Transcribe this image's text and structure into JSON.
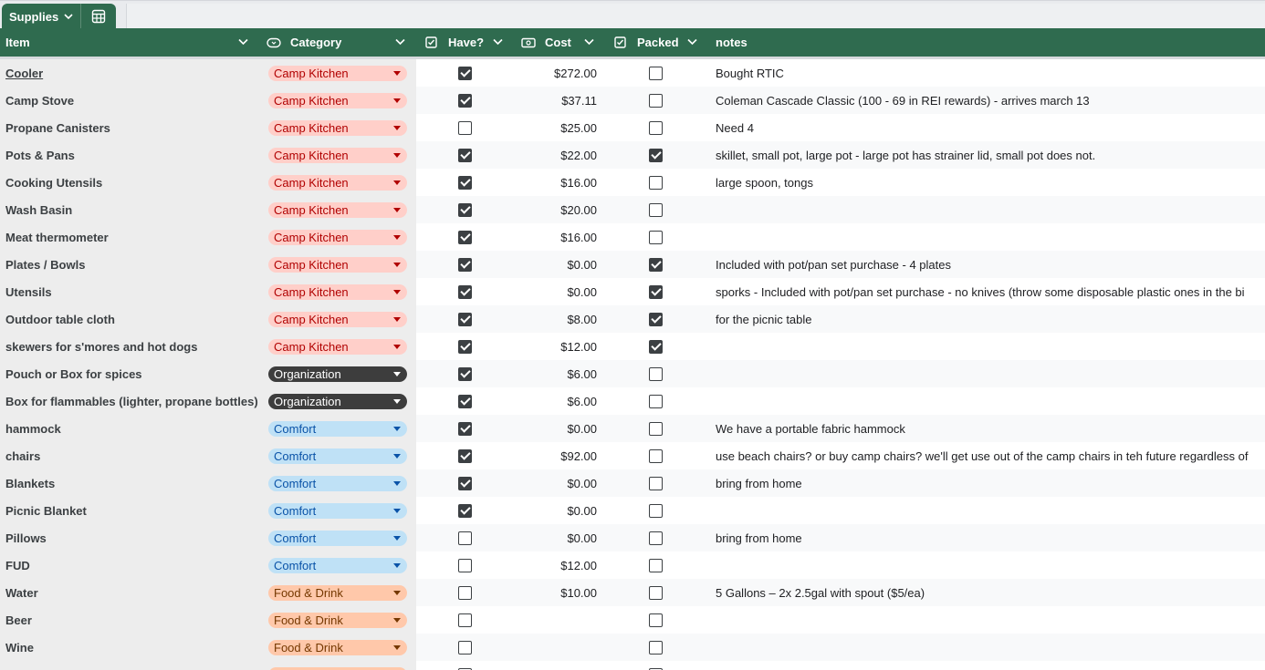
{
  "sheet": {
    "tab_name": "Supplies"
  },
  "columns": {
    "item": "Item",
    "category": "Category",
    "have": "Have?",
    "cost": "Cost",
    "packed": "Packed",
    "notes": "notes"
  },
  "category_styles": {
    "Camp Kitchen": {
      "bg": "#ffcfc9",
      "fg": "#b10202"
    },
    "Organization": {
      "bg": "#3d3d3d",
      "fg": "#ffffff"
    },
    "Comfort": {
      "bg": "#bfe1f6",
      "fg": "#0a53a8"
    },
    "Food & Drink": {
      "bg": "#ffc8aa",
      "fg": "#753800"
    }
  },
  "rows": [
    {
      "item": "Cooler",
      "category": "Camp Kitchen",
      "have": true,
      "cost": "$272.00",
      "packed": false,
      "notes": "Bought RTIC"
    },
    {
      "item": "Camp Stove",
      "category": "Camp Kitchen",
      "have": true,
      "cost": "$37.11",
      "packed": false,
      "notes": "Coleman Cascade Classic (100 - 69 in REI rewards) - arrives march 13"
    },
    {
      "item": "Propane Canisters",
      "category": "Camp Kitchen",
      "have": false,
      "cost": "$25.00",
      "packed": false,
      "notes": "Need 4"
    },
    {
      "item": "Pots & Pans",
      "category": "Camp Kitchen",
      "have": true,
      "cost": "$22.00",
      "packed": true,
      "notes": "skillet, small pot, large pot - large pot has strainer lid, small pot does not."
    },
    {
      "item": "Cooking Utensils",
      "category": "Camp Kitchen",
      "have": true,
      "cost": "$16.00",
      "packed": false,
      "notes": "large spoon, tongs"
    },
    {
      "item": "Wash Basin",
      "category": "Camp Kitchen",
      "have": true,
      "cost": "$20.00",
      "packed": false,
      "notes": ""
    },
    {
      "item": "Meat thermometer",
      "category": "Camp Kitchen",
      "have": true,
      "cost": "$16.00",
      "packed": false,
      "notes": ""
    },
    {
      "item": "Plates / Bowls",
      "category": "Camp Kitchen",
      "have": true,
      "cost": "$0.00",
      "packed": true,
      "notes": "Included with pot/pan set purchase - 4 plates"
    },
    {
      "item": "Utensils",
      "category": "Camp Kitchen",
      "have": true,
      "cost": "$0.00",
      "packed": true,
      "notes": "sporks - Included with pot/pan set purchase - no knives (throw some disposable plastic ones in the bi"
    },
    {
      "item": "Outdoor table cloth",
      "category": "Camp Kitchen",
      "have": true,
      "cost": "$8.00",
      "packed": true,
      "notes": "for the picnic table"
    },
    {
      "item": "skewers for s'mores and hot dogs",
      "category": "Camp Kitchen",
      "have": true,
      "cost": "$12.00",
      "packed": true,
      "notes": ""
    },
    {
      "item": "Pouch or Box for spices",
      "category": "Organization",
      "have": true,
      "cost": "$6.00",
      "packed": false,
      "notes": ""
    },
    {
      "item": "Box for flammables (lighter, propane bottles)",
      "category": "Organization",
      "have": true,
      "cost": "$6.00",
      "packed": false,
      "notes": ""
    },
    {
      "item": "hammock",
      "category": "Comfort",
      "have": true,
      "cost": "$0.00",
      "packed": false,
      "notes": "We have a portable fabric hammock"
    },
    {
      "item": "chairs",
      "category": "Comfort",
      "have": true,
      "cost": "$92.00",
      "packed": false,
      "notes": "use beach chairs? or buy camp chairs? we'll get use out of the camp chairs in teh future regardless of"
    },
    {
      "item": "Blankets",
      "category": "Comfort",
      "have": true,
      "cost": "$0.00",
      "packed": false,
      "notes": "bring from home"
    },
    {
      "item": "Picnic Blanket",
      "category": "Comfort",
      "have": true,
      "cost": "$0.00",
      "packed": false,
      "notes": ""
    },
    {
      "item": "Pillows",
      "category": "Comfort",
      "have": false,
      "cost": "$0.00",
      "packed": false,
      "notes": "bring from home"
    },
    {
      "item": "FUD",
      "category": "Comfort",
      "have": false,
      "cost": "$12.00",
      "packed": false,
      "notes": ""
    },
    {
      "item": "Water",
      "category": "Food & Drink",
      "have": false,
      "cost": "$10.00",
      "packed": false,
      "notes": "5 Gallons – 2x 2.5gal with spout ($5/ea)"
    },
    {
      "item": "Beer",
      "category": "Food & Drink",
      "have": false,
      "cost": "",
      "packed": false,
      "notes": ""
    },
    {
      "item": "Wine",
      "category": "Food & Drink",
      "have": false,
      "cost": "",
      "packed": false,
      "notes": ""
    },
    {
      "item": "",
      "category": "Food & Drink",
      "have": false,
      "cost": "",
      "packed": false,
      "notes": ""
    }
  ]
}
